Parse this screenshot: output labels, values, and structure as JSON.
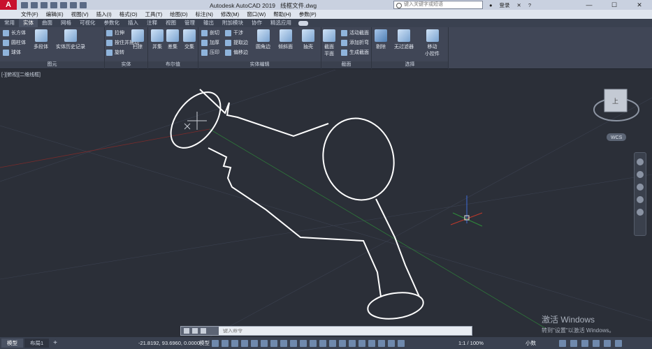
{
  "title": {
    "app": "Autodesk AutoCAD 2019",
    "file": "线框文件.dwg",
    "search_placeholder": "键入关键字或短语",
    "login": "登录"
  },
  "menu": [
    "文件(F)",
    "编辑(E)",
    "视图(V)",
    "插入(I)",
    "格式(O)",
    "工具(T)",
    "绘图(D)",
    "标注(N)",
    "修改(M)",
    "窗口(W)",
    "帮助(H)",
    "参数(P)"
  ],
  "tabs": [
    "常用",
    "实体",
    "曲面",
    "网格",
    "可视化",
    "参数化",
    "插入",
    "注释",
    "视图",
    "管理",
    "输出",
    "附加模块",
    "协作",
    "精选应用"
  ],
  "active_tab": "实体",
  "ribbon": {
    "primitive": {
      "label": "图元",
      "box": "长方体",
      "cylinder": "圆柱体",
      "sphere": "球体",
      "polysolid": "多段体",
      "history": "实体历史记录"
    },
    "solid": {
      "label": "实体",
      "extrude": "拉伸",
      "presspull": "按住并拖动",
      "revolve": "旋转",
      "sweep": "扫掠"
    },
    "boolean": {
      "label": "布尔值",
      "union": "并集",
      "subtract": "差集",
      "intersect": "交集"
    },
    "solid_edit": {
      "label": "实体编辑",
      "slice": "剖切",
      "interfere": "干涉",
      "thicken": "加厚",
      "extract_edges": "提取边",
      "imprint": "压印",
      "offset_edge": "偏移边",
      "fillet_edge": "圆角边",
      "taper": "倾斜面",
      "shell": "抽壳"
    },
    "section": {
      "label": "截面",
      "plane": "截面\n平面",
      "live": "活动截面",
      "add_jog": "添加折弯",
      "generate": "生成截面"
    },
    "selection": {
      "label": "选择",
      "culling": "剔除",
      "no_filter": "无过滤器",
      "gizmo": "移动\n小控件"
    }
  },
  "viewport_label": "[-][俯视][二维线框]",
  "viewcube": {
    "top": "上",
    "wcs": "WCS"
  },
  "watermark": {
    "line1": "激活 Windows",
    "line2": "转到\"设置\"以激活 Windows。"
  },
  "command": {
    "placeholder": "键入命令"
  },
  "status": {
    "layouts": [
      "模型",
      "布局1"
    ],
    "coords": "-21.8192, 93.6960, 0.0000",
    "model": "模型",
    "scale": "1:1 / 100%",
    "workspace": "小数"
  },
  "colors": {
    "background": "#2b2f38",
    "wire": "#ffffff",
    "x_axis": "#c0392b",
    "y_axis": "#2e8b3a",
    "z_axis": "#3d6bd6",
    "accent": "#c8102e"
  }
}
